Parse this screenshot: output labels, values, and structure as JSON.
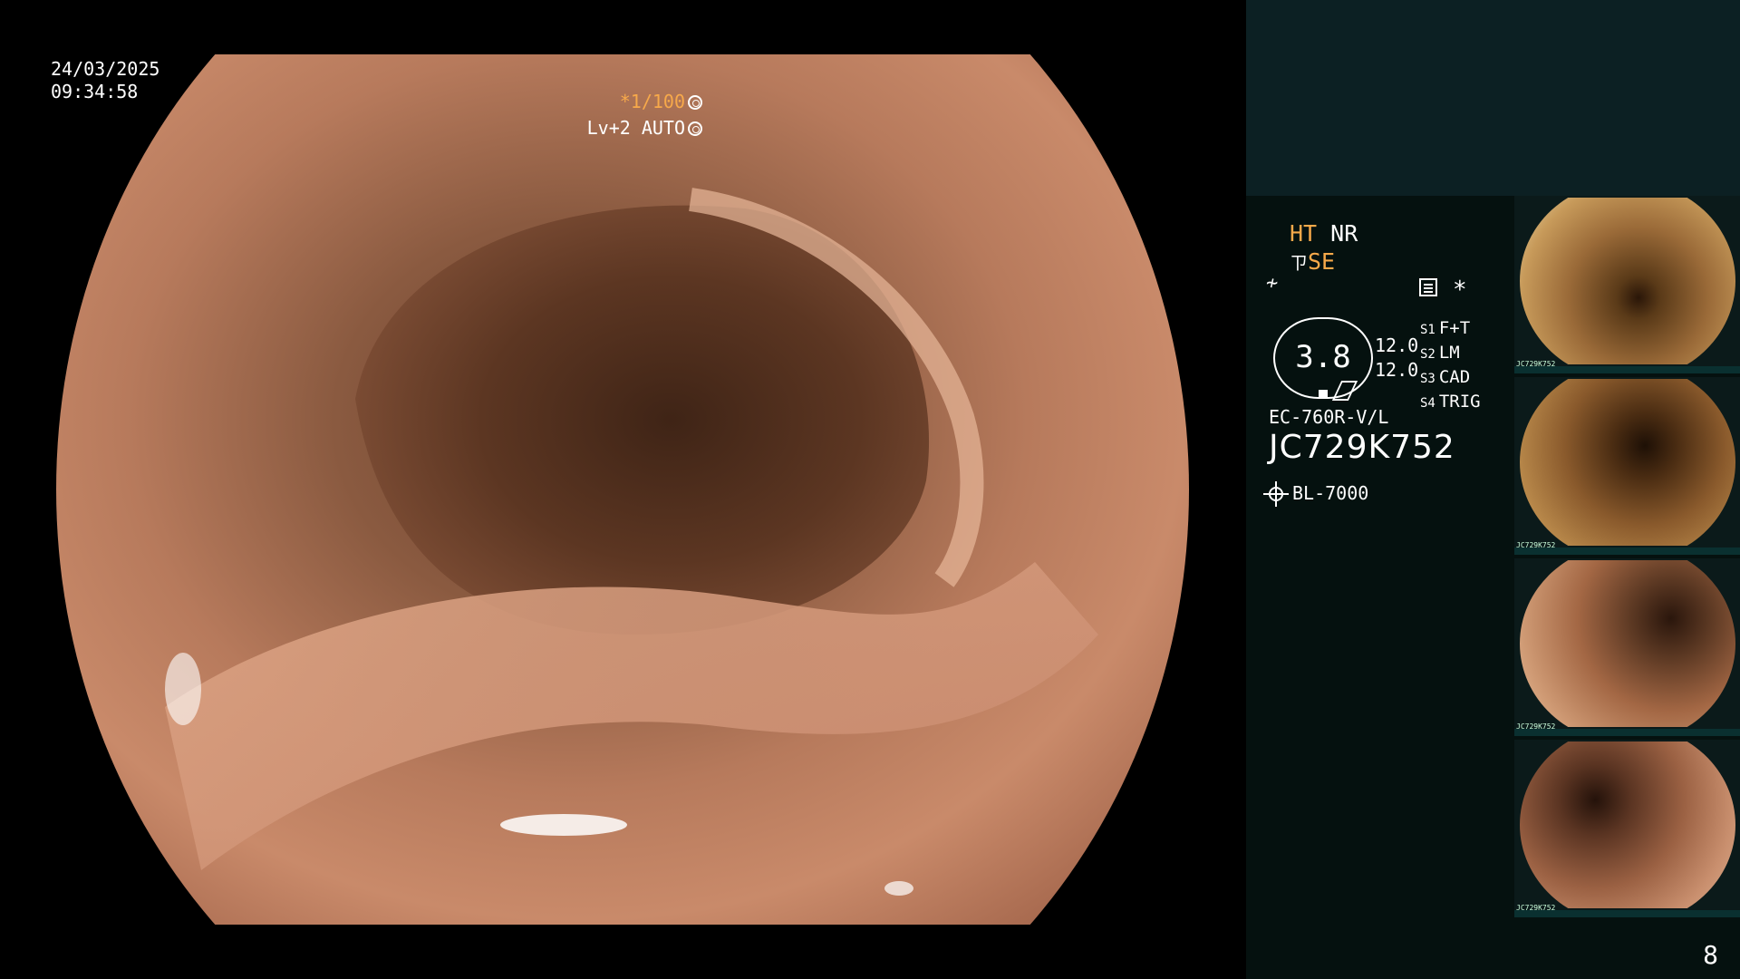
{
  "overlay": {
    "date": "24/03/2025",
    "time": "09:34:58",
    "zoom": "*1/100",
    "level": "Lv+2 AUTO"
  },
  "panel": {
    "flag_ht": "HT",
    "flag_nr": "NR",
    "flag_se": "SE",
    "gauge_value": "3.8",
    "setting_1": "12.0",
    "setting_2": "12.0",
    "scope_functions": [
      {
        "key": "S1",
        "value": "F+T"
      },
      {
        "key": "S2",
        "value": "LM"
      },
      {
        "key": "S3",
        "value": "CAD"
      },
      {
        "key": "S4",
        "value": "TRIG"
      }
    ],
    "asterisk": "*",
    "scope_model": "EC-760R-V/L",
    "scope_serial": "JC729K752",
    "light_source": "BL-7000",
    "page_number": "8"
  },
  "thumbnails": [
    {
      "tone": "#9a6a38",
      "label": "JC729K752"
    },
    {
      "tone": "#8a5a2c",
      "label": "JC729K752"
    },
    {
      "tone": "#a36744",
      "label": "JC729K752"
    },
    {
      "tone": "#9b6143",
      "label": "JC729K752"
    }
  ],
  "colors": {
    "accent_amber": "#f7a94a",
    "panel_bg": "#05110f",
    "panel_top": "#0c2023"
  }
}
